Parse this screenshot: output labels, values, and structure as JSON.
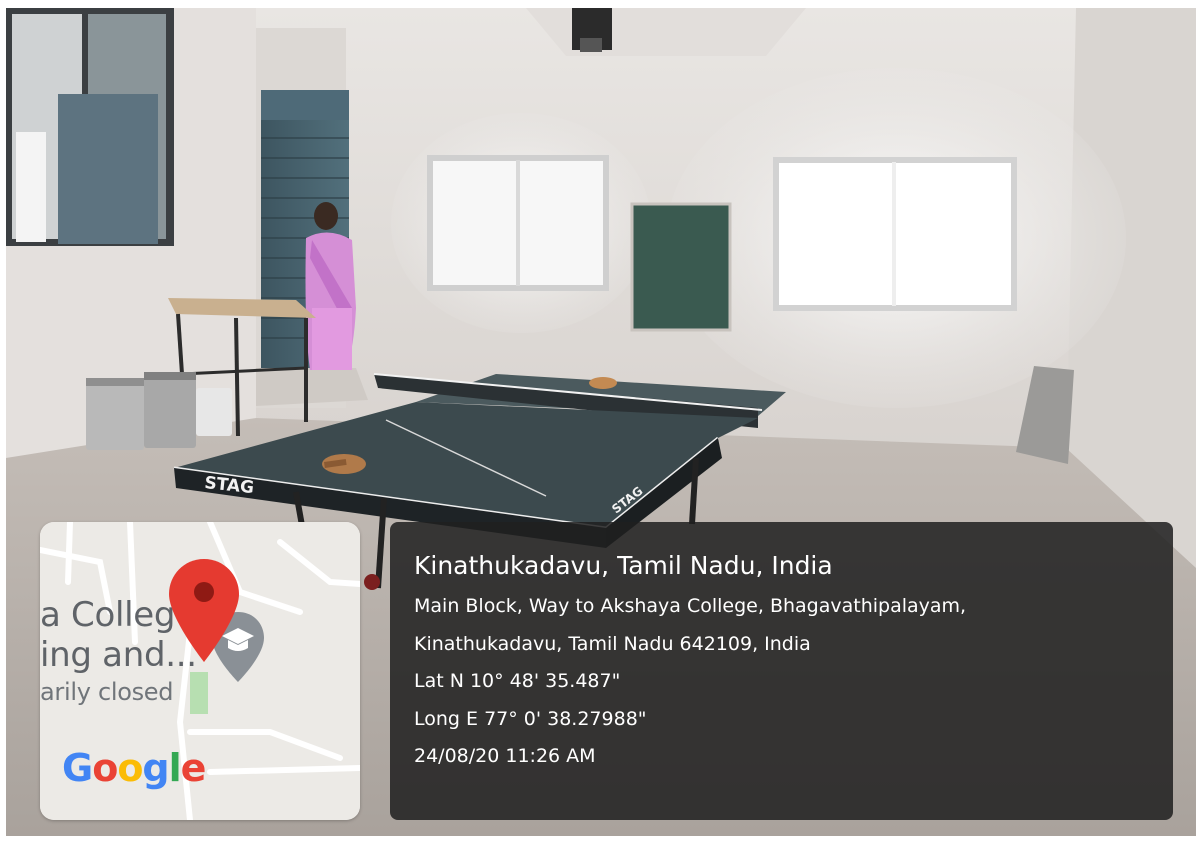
{
  "scene": {
    "table_brand_left": "STAG",
    "table_brand_right": "STAG"
  },
  "map": {
    "label_line1": "a College",
    "label_line2": "ing and...",
    "label_line3": "arily closed",
    "pin_icon": "map-pin-icon",
    "place_icon": "graduation-cap-icon",
    "logo": {
      "letters": [
        "G",
        "o",
        "o",
        "g",
        "l",
        "e"
      ],
      "colors": [
        "#4285f4",
        "#ea4335",
        "#fbbc05",
        "#4285f4",
        "#34a853",
        "#ea4335"
      ]
    }
  },
  "location": {
    "title": "Kinathukadavu, Tamil Nadu, India",
    "address_line1": "Main Block, Way to Akshaya College, Bhagavathipalayam,",
    "address_line2": "Kinathukadavu, Tamil Nadu 642109, India",
    "latitude": "Lat N 10° 48' 35.487\"",
    "longitude": "Long E 77° 0' 38.27988\"",
    "timestamp": "24/08/20 11:26 AM"
  }
}
